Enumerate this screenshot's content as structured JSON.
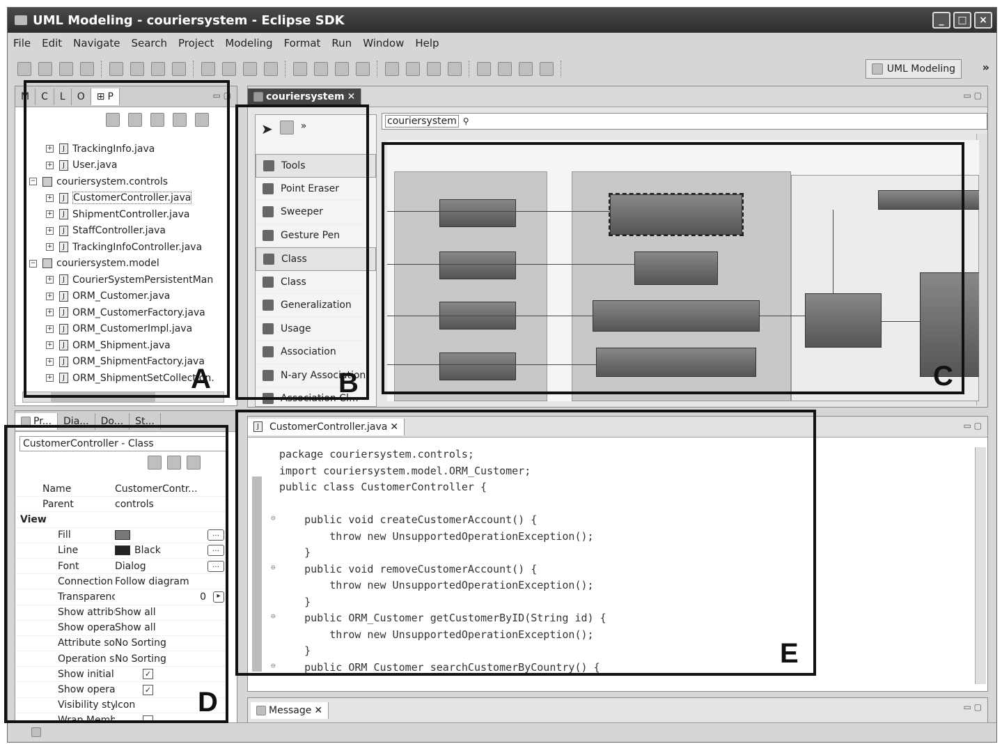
{
  "window": {
    "title": "UML Modeling - couriersystem - Eclipse SDK"
  },
  "menu": [
    "File",
    "Edit",
    "Navigate",
    "Search",
    "Project",
    "Modeling",
    "Format",
    "Run",
    "Window",
    "Help"
  ],
  "toolbar": {
    "perspective": "UML Modeling",
    "overflow": "»"
  },
  "explorer": {
    "tabs": [
      "M",
      "C",
      "L",
      "O",
      "P"
    ],
    "items": [
      {
        "label": "TrackingInfo.java",
        "kind": "file",
        "indent": 2
      },
      {
        "label": "User.java",
        "kind": "file",
        "indent": 2
      },
      {
        "label": "couriersystem.controls",
        "kind": "package",
        "indent": 1
      },
      {
        "label": "CustomerController.java",
        "kind": "file",
        "indent": 2
      },
      {
        "label": "ShipmentController.java",
        "kind": "file",
        "indent": 2
      },
      {
        "label": "StaffController.java",
        "kind": "file",
        "indent": 2
      },
      {
        "label": "TrackingInfoController.java",
        "kind": "file",
        "indent": 2
      },
      {
        "label": "couriersystem.model",
        "kind": "package",
        "indent": 1
      },
      {
        "label": "CourierSystemPersistentMan",
        "kind": "file",
        "indent": 2
      },
      {
        "label": "ORM_Customer.java",
        "kind": "file",
        "indent": 2
      },
      {
        "label": "ORM_CustomerFactory.java",
        "kind": "file",
        "indent": 2
      },
      {
        "label": "ORM_CustomerImpl.java",
        "kind": "file",
        "indent": 2
      },
      {
        "label": "ORM_Shipment.java",
        "kind": "file",
        "indent": 2
      },
      {
        "label": "ORM_ShipmentFactory.java",
        "kind": "file",
        "indent": 2
      },
      {
        "label": "ORM_ShipmentSetCollection.",
        "kind": "file",
        "indent": 2
      }
    ]
  },
  "editor": {
    "tab": "couriersystem",
    "breadcrumb": "couriersystem"
  },
  "palette": {
    "items": [
      {
        "label": "Tools",
        "drawer": true
      },
      {
        "label": "Point Eraser",
        "drawer": false
      },
      {
        "label": "Sweeper",
        "drawer": false
      },
      {
        "label": "Gesture Pen",
        "drawer": false
      },
      {
        "label": "Class",
        "drawer": true
      },
      {
        "label": "Class",
        "drawer": false
      },
      {
        "label": "Generalization",
        "drawer": false
      },
      {
        "label": "Usage",
        "drawer": false
      },
      {
        "label": "Association",
        "drawer": false
      },
      {
        "label": "N-ary Association",
        "drawer": false
      },
      {
        "label": "Association Cl…",
        "drawer": false
      }
    ]
  },
  "properties": {
    "tabs": [
      "Pr...",
      "Dia...",
      "Do...",
      "St..."
    ],
    "header": "CustomerController - Class",
    "rows": [
      {
        "key": "Name",
        "value": "CustomerContr...",
        "type": "text",
        "level": 0
      },
      {
        "key": "Parent",
        "value": "controls",
        "type": "text",
        "level": 0
      },
      {
        "key": "View",
        "value": "",
        "type": "group",
        "level": 0
      },
      {
        "key": "Fill",
        "value": "",
        "type": "swatch",
        "color": "#777777",
        "level": 1
      },
      {
        "key": "Line",
        "value": "Black",
        "type": "swatch",
        "color": "#222222",
        "level": 1
      },
      {
        "key": "Font",
        "value": "Dialog",
        "type": "dots",
        "level": 1
      },
      {
        "key": "Connection p...",
        "value": "Follow diagram",
        "type": "text",
        "level": 1
      },
      {
        "key": "Transparency",
        "value": "0",
        "type": "spin",
        "level": 1
      },
      {
        "key": "Show attribut...",
        "value": "Show all",
        "type": "text",
        "level": 1
      },
      {
        "key": "Show operati...",
        "value": "Show all",
        "type": "text",
        "level": 1
      },
      {
        "key": "Attribute sort ...",
        "value": "No Sorting",
        "type": "text",
        "level": 1
      },
      {
        "key": "Operation sor...",
        "value": "No Sorting",
        "type": "text",
        "level": 1
      },
      {
        "key": "Show initial at...",
        "value": "",
        "type": "check",
        "level": 1
      },
      {
        "key": "Show operati...",
        "value": "",
        "type": "check",
        "level": 1
      },
      {
        "key": "Visibility style",
        "value": "Icon",
        "type": "text",
        "level": 1
      },
      {
        "key": "Wrap Members",
        "value": "",
        "type": "uncheck",
        "level": 1
      }
    ]
  },
  "code": {
    "tab": "CustomerController.java",
    "lines": [
      {
        "text": "package couriersystem.controls;",
        "marker": false
      },
      {
        "text": "import couriersystem.model.ORM_Customer;",
        "marker": false
      },
      {
        "text": "public class CustomerController {",
        "marker": false
      },
      {
        "text": "",
        "marker": false
      },
      {
        "text": "    public void createCustomerAccount() {",
        "marker": true
      },
      {
        "text": "        throw new UnsupportedOperationException();",
        "marker": false
      },
      {
        "text": "    }",
        "marker": false
      },
      {
        "text": "    public void removeCustomerAccount() {",
        "marker": true
      },
      {
        "text": "        throw new UnsupportedOperationException();",
        "marker": false
      },
      {
        "text": "    }",
        "marker": false
      },
      {
        "text": "    public ORM_Customer getCustomerByID(String id) {",
        "marker": true
      },
      {
        "text": "        throw new UnsupportedOperationException();",
        "marker": false
      },
      {
        "text": "    }",
        "marker": false
      },
      {
        "text": "    public ORM_Customer searchCustomerByCountry() {",
        "marker": true
      }
    ]
  },
  "message": {
    "tab": "Message"
  },
  "callouts": [
    "A",
    "B",
    "C",
    "D",
    "E"
  ]
}
